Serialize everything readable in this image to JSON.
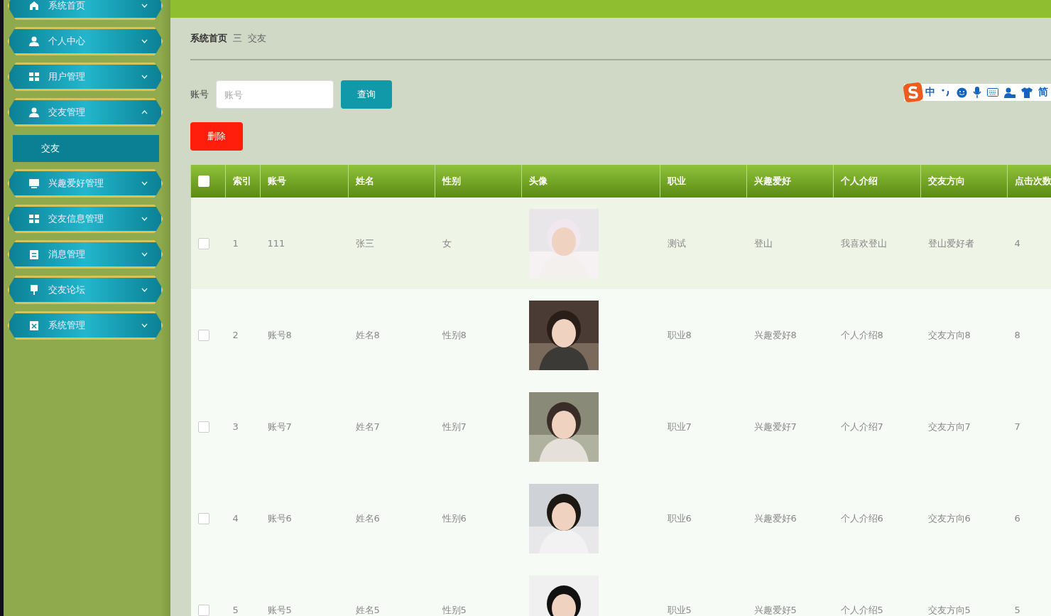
{
  "sidebar": {
    "items": [
      {
        "label": "系统首页",
        "expanded": false
      },
      {
        "label": "个人中心",
        "expanded": false
      },
      {
        "label": "用户管理",
        "expanded": false
      },
      {
        "label": "交友管理",
        "expanded": true,
        "children": [
          {
            "label": "交友",
            "selected": true
          }
        ]
      },
      {
        "label": "兴趣爱好管理",
        "expanded": false
      },
      {
        "label": "交友信息管理",
        "expanded": false
      },
      {
        "label": "消息管理",
        "expanded": false
      },
      {
        "label": "交友论坛",
        "expanded": false
      },
      {
        "label": "系统管理",
        "expanded": false
      }
    ]
  },
  "breadcrumb": {
    "items": [
      "系统首页",
      "交友"
    ],
    "separator": "三"
  },
  "search": {
    "label": "账号",
    "placeholder": "账号",
    "button": "查询"
  },
  "delete_button": "删除",
  "ime_toolbar": {
    "texts": [
      "中",
      "简"
    ]
  },
  "table": {
    "header_checked": false,
    "columns": [
      "索引",
      "账号",
      "姓名",
      "性别",
      "头像",
      "职业",
      "兴趣爱好",
      "个人介绍",
      "交友方向",
      "点击次数"
    ],
    "rows": [
      {
        "checked": false,
        "highlighted": true,
        "cells": [
          "1",
          "111",
          "张三",
          "女",
          {
            "kind": "picture"
          },
          "测试",
          "登山",
          "我喜欢登山",
          "登山爱好者",
          "4"
        ]
      },
      {
        "checked": false,
        "highlighted": false,
        "cells": [
          "2",
          "账号8",
          "姓名8",
          "性别8",
          {
            "kind": "picture"
          },
          "职业8",
          "兴趣爱好8",
          "个人介绍8",
          "交友方向8",
          "8"
        ]
      },
      {
        "checked": false,
        "highlighted": false,
        "cells": [
          "3",
          "账号7",
          "姓名7",
          "性别7",
          {
            "kind": "picture"
          },
          "职业7",
          "兴趣爱好7",
          "个人介绍7",
          "交友方向7",
          "7"
        ]
      },
      {
        "checked": false,
        "highlighted": false,
        "cells": [
          "4",
          "账号6",
          "姓名6",
          "性别6",
          {
            "kind": "picture"
          },
          "职业6",
          "兴趣爱好6",
          "个人介绍6",
          "交友方向6",
          "6"
        ]
      },
      {
        "checked": false,
        "highlighted": false,
        "cells": [
          "5",
          "账号5",
          "姓名5",
          "性别5",
          {
            "kind": "picture"
          },
          "职业5",
          "兴趣爱好5",
          "个人介绍5",
          "交友方向5",
          "5"
        ]
      }
    ]
  }
}
